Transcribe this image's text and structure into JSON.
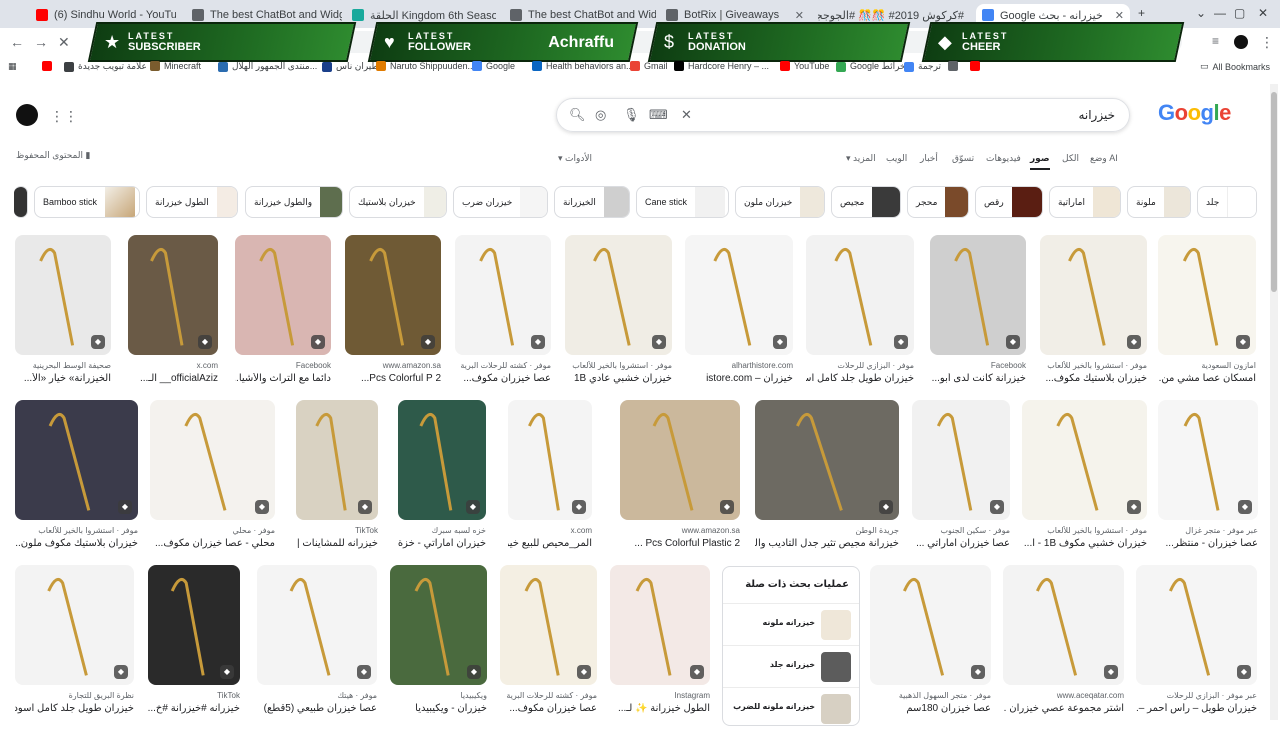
{
  "browser": {
    "tabs": [
      {
        "label": "(6) Sindhu World - YouTube",
        "color": "#ff0000"
      },
      {
        "label": "The best ChatBot and Widgets",
        "color": "#5f6368"
      },
      {
        "label": "الحلقة Kingdom 6th Season انمي",
        "color": "#19a99c"
      },
      {
        "label": "The best ChatBot and Widgets",
        "color": "#5f6368"
      },
      {
        "label": "BotRix | Giveaways",
        "color": "#5f6368"
      },
      {
        "label": "#كركوش 2019# 🎊🎊 #الجوججح",
        "color": "#000000"
      },
      {
        "label": "خيزرانه - بحث Google",
        "color": "#4285f4"
      }
    ],
    "new_tab": "+",
    "window_controls": [
      "⌄",
      "—",
      "▢",
      "✕"
    ],
    "nav": {
      "back": "←",
      "forward": "→",
      "reload": "✕"
    }
  },
  "alerts": [
    {
      "top": "LATEST",
      "bottom": "SUBSCRIBER",
      "icon": "★",
      "name": ""
    },
    {
      "top": "LATEST",
      "bottom": "FOLLOWER",
      "icon": "♥",
      "name": "Achraffu"
    },
    {
      "top": "LATEST",
      "bottom": "DONATION",
      "icon": "$",
      "name": ""
    },
    {
      "top": "LATEST",
      "bottom": "CHEER",
      "icon": "◆",
      "name": ""
    }
  ],
  "bookmarks": [
    {
      "label": "",
      "color": "#ff0000"
    },
    {
      "label": "علامة تبويب جديدة",
      "color": "#3c4043"
    },
    {
      "label": "Minecraft",
      "color": "#7a5c2e"
    },
    {
      "label": "منتدى الجمهور الهلال...",
      "color": "#2b6cb0"
    },
    {
      "label": "طيران ناس",
      "color": "#1a3f8a"
    },
    {
      "label": "Naruto Shippuuden...",
      "color": "#e07b00"
    },
    {
      "label": "Google",
      "color": "#4285f4"
    },
    {
      "label": "Health behaviors an...",
      "color": "#0a66c2"
    },
    {
      "label": "Gmail",
      "color": "#ea4335"
    },
    {
      "label": "Hardcore Henry – ...",
      "color": "#000000"
    },
    {
      "label": "YouTube",
      "color": "#ff0000"
    },
    {
      "label": "Google خرائط",
      "color": "#34a853"
    },
    {
      "label": "ترجمة",
      "color": "#4285f4"
    },
    {
      "label": "",
      "color": "#5f6368"
    },
    {
      "label": "",
      "color": "#ff0000"
    }
  ],
  "all_bookmarks": "All Bookmarks",
  "google": {
    "query": "خيزرانه",
    "logo": "Google",
    "saved_content": "المحتوى المحفوظ",
    "tools": "الأدوات",
    "filters": [
      "وضع AI",
      "الكل",
      "صور",
      "فيديوهات",
      "تسوّق",
      "أخبار",
      "الويب",
      "المزيد"
    ],
    "active_filter": "صور",
    "chips": [
      "جلد",
      "ملونة",
      "اماراتية",
      "رقص",
      "محجر",
      "مجيص",
      "خيزران ملون",
      "Cane stick",
      "الخيزرانة",
      "خيزران ضرب",
      "خيزران بلاستيك",
      "والطول خيزرانة",
      "الطول خيزرانة",
      "Bamboo stick"
    ],
    "results_row1": [
      {
        "source": "صحيفة الوسط البحرينية",
        "title": "الخيزرانة» خيار «الأ..."
      },
      {
        "source": "x.com",
        "title": "officialAziz__ الـ..."
      },
      {
        "source": "Facebook",
        "title": "دائما مع التراث والأشيا..."
      },
      {
        "source": "www.amazon.sa",
        "title": "2 Pcs Colorful P..."
      },
      {
        "source": "موفر · كشته للرحلات البرية",
        "title": "عصا خيزران مكوف..."
      },
      {
        "source": "موفر · استشروا بالخير للألعاب",
        "title": "خيزران خشبي عادي 1B"
      },
      {
        "source": "alharthistore.com",
        "title": "خيزران – istore.com"
      },
      {
        "source": "موفر · البزازي للرحلات",
        "title": "خيزران طويل جلد كامل اس..."
      },
      {
        "source": "Facebook",
        "title": "خيزرانة كانت لدى أبو..."
      },
      {
        "source": "موفر · استشروا بالخير للألعاب",
        "title": "خيزران بلاستيك مكوف..."
      },
      {
        "source": "امازون السعودية",
        "title": "امسكان عصا مشي من..."
      }
    ],
    "results_row2": [
      {
        "source": "موفر · استشروا بالخير للألعاب",
        "title": "خيزران بلاستيك مكوف ملون..."
      },
      {
        "source": "موفر · محلي",
        "title": "محلي - عصا خيزران مكوف..."
      },
      {
        "source": "TikTok",
        "title": "خيزرانه للمشاينات | k..."
      },
      {
        "source": "خزه لسبه سبرك",
        "title": "خيزران اماراتي - خزة..."
      },
      {
        "source": "x.com",
        "title": "المر_محيص للبيع خيزر..."
      },
      {
        "source": "www.amazon.sa",
        "title": "2 Pcs Colorful Plastic ..."
      },
      {
        "source": "جريدة الوطن",
        "title": "خيزرانة مجيص تثير جدل التأديب والـ..."
      },
      {
        "source": "موفر · سكين الجنوب",
        "title": "عصا خيزران اماراتي ..."
      },
      {
        "source": "موفر · استشروا بالخير للألعاب",
        "title": "خيزران خشبي مكوف 1B - ا..."
      },
      {
        "source": "عبر موفر · متجر غزال",
        "title": "عصا خيزران - منتظر..."
      }
    ],
    "results_row3": [
      {
        "source": "نظرة البريق للتجارة",
        "title": "خيزران طويل جلد كامل اسود"
      },
      {
        "source": "TikTok",
        "title": "خيزرانه #خيزرانة #خ..."
      },
      {
        "source": "موفر · هيتك",
        "title": "عصا خيزران طبيعي (5قطع)"
      },
      {
        "source": "ويكيبيديا",
        "title": "خيزران - ويكيبيديا"
      },
      {
        "source": "موفر · كشته للرحلات البرية",
        "title": "عصا خيزران مكوف..."
      },
      {
        "source": "Instagram",
        "title": "الطول خيزرانة ✨ لـ..."
      },
      {
        "source": "موفر · متجر السهول الذهبية",
        "title": "عصا خيزران 180سم"
      },
      {
        "source": "www.aceqatar.com",
        "title": "اشتر مجموعة عصي خيزران ..."
      },
      {
        "source": "عبر موفر · البزازي للرحلات",
        "title": "خيزران طويل – رأس أحمر –..."
      }
    ],
    "related": {
      "heading": "عمليات بحث ذات صلة",
      "items": [
        "خيزرانه ملونه",
        "خيزرانه جلد",
        "خيزرانه ملونه للضرب"
      ]
    }
  }
}
